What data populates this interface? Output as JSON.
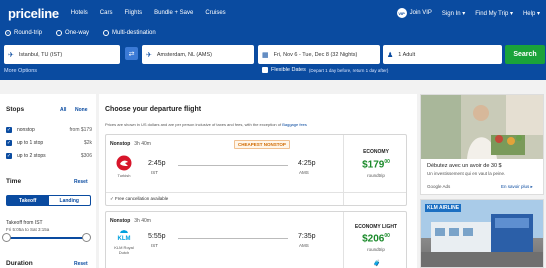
{
  "nav": {
    "logo": "priceline",
    "links": [
      "Hotels",
      "Cars",
      "Flights",
      "Bundle + Save",
      "Cruises"
    ],
    "vip_badge": "VIP",
    "join_vip": "Join VIP",
    "sign_in": "Sign In ▾",
    "find_trip": "Find My Trip ▾",
    "help": "Help ▾"
  },
  "search": {
    "trip_types": [
      "Round-trip",
      "One-way",
      "Multi-destination"
    ],
    "selected_trip_type": "Round-trip",
    "origin": "Istanbul, TU (IST)",
    "destination": "Amsterdam, NL (AMS)",
    "dates": "Fri, Nov 6 - Tue, Dec 8 (32 Nights)",
    "travelers": "1 Adult",
    "search_label": "Search",
    "more_options": "More Options",
    "flex_label": "Flexible Dates",
    "flex_note": "(Depart 1 day before, return 1 day after)"
  },
  "sidebar": {
    "stops_title": "Stops",
    "all": "All",
    "none": "None",
    "stops": [
      {
        "label": "nonstop",
        "price": "from $179"
      },
      {
        "label": "up to 1 stop",
        "price": "$2k"
      },
      {
        "label": "up to 2 stops",
        "price": "$306"
      }
    ],
    "time_title": "Time",
    "reset": "Reset",
    "takeoff": "Takeoff",
    "landing": "Landing",
    "takeoff_from": "Takeoff from IST",
    "takeoff_range": "Fri 5:05a to Sat 3:15a",
    "duration_title": "Duration"
  },
  "main": {
    "title": "Choose your departure flight",
    "note_prefix": "Prices are shown in US dollars and are per person inclusive of taxes and fees, with the exception of ",
    "note_link": "Baggage fees",
    "flights": [
      {
        "stops": "Nonstop",
        "duration": "3h 40m",
        "badge": "CHEAPEST NONSTOP",
        "airline": "Turkish",
        "depart_time": "2:45p",
        "depart_code": "IST",
        "arrive_time": "4:25p",
        "arrive_code": "AMS",
        "fare_class": "ECONOMY",
        "price": "179",
        "price_cents": "00",
        "price_sub": "roundtrip",
        "free_cancel": "✓ Free cancellation available"
      },
      {
        "stops": "Nonstop",
        "duration": "3h 40m",
        "airline": "KLM Royal Dutch",
        "depart_time": "5:55p",
        "depart_code": "IST",
        "arrive_time": "7:35p",
        "arrive_code": "AMS",
        "fare_class": "ECONOMY LIGHT",
        "price": "206",
        "price_cents": "00",
        "price_sub": "roundtrip"
      }
    ]
  },
  "ads": {
    "ad1_title": "Débutez avec un avoir de 30 $",
    "ad1_sub": "Un investissement qui en vaut la peine.",
    "ad1_source": "Google Ads",
    "ad1_more": "En savoir plus ▸",
    "ad2_label": "KLM AIRLINE"
  },
  "colors": {
    "brand_blue": "#0a4ba0",
    "search_green": "#1aa33a",
    "price_green": "#1a8a2a",
    "badge_orange": "#d06a00"
  }
}
